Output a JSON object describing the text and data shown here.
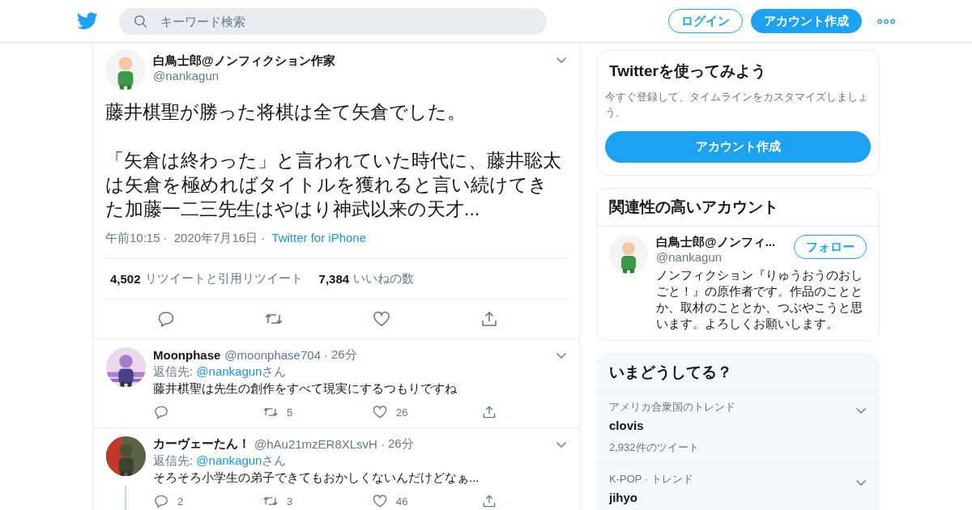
{
  "header": {
    "search": {
      "placeholder": "キーワード検索"
    },
    "login": "ログイン",
    "signup": "アカウント作成"
  },
  "tweet": {
    "name": "白鳥士郎@ノンフィクション作家",
    "handle": "@nankagun",
    "paragraphs": [
      "藤井棋聖が勝った将棋は全て矢倉でした。",
      "「矢倉は終わった」と言われていた時代に、藤井聡太は矢倉を極めればタイトルを獲れると言い続けてきた加藤一二三先生はやはり神武以来の天才..."
    ],
    "separator": "·",
    "time": "午前10:15",
    "date": "2020年7月16日",
    "source": "Twitter for iPhone",
    "stats": [
      {
        "count": "4,502",
        "label": "リツイートと引用リツイート"
      },
      {
        "count": "7,384",
        "label": "いいねの数"
      }
    ]
  },
  "replies": [
    {
      "name": "Moonphase",
      "handle": "@moonphase704",
      "separator": "·",
      "time": "26分",
      "reply_prefix": "返信先: ",
      "reply_to": "@nankagun",
      "reply_suffix": "さん",
      "text": "藤井棋聖は先生の創作をすべて現実にするつもりですね",
      "retweets": "5",
      "likes": "26",
      "thread": false
    },
    {
      "name": "カーヴェーたん！",
      "handle": "@hAu21mzER8XLsvH",
      "separator": "·",
      "time": "26分",
      "reply_prefix": "返信先: ",
      "reply_to": "@nankagun",
      "reply_suffix": "さん",
      "text": "そろそろ小学生の弟子できてもおかしくないんだけどなぁ...",
      "replies": "2",
      "retweets": "3",
      "likes": "46",
      "thread": true
    }
  ],
  "sidebar": {
    "signup_card": {
      "title": "Twitterを使ってみよう",
      "description": "今すぐ登録して、タイムラインをカスタマイズしましょう。",
      "button": "アカウント作成"
    },
    "related_card": {
      "title": "関連性の高いアカウント",
      "accounts": [
        {
          "name": "白鳥士郎@ノンフィ...",
          "handle": "@nankagun",
          "follow": "フォロー",
          "bio": "ノンフィクション『りゅうおうのおしごと！』の原作者です。作品のこととか、取材のこととか、つぶやこうと思います。よろしくお願いします。"
        }
      ]
    },
    "trends_card": {
      "title": "いまどうしてる？",
      "trends": [
        {
          "context": "アメリカ合衆国のトレンド",
          "topic": "clovis",
          "count": "2,932件のツイート"
        },
        {
          "context": "K-POP · トレンド",
          "topic": "jihyo"
        }
      ]
    }
  }
}
